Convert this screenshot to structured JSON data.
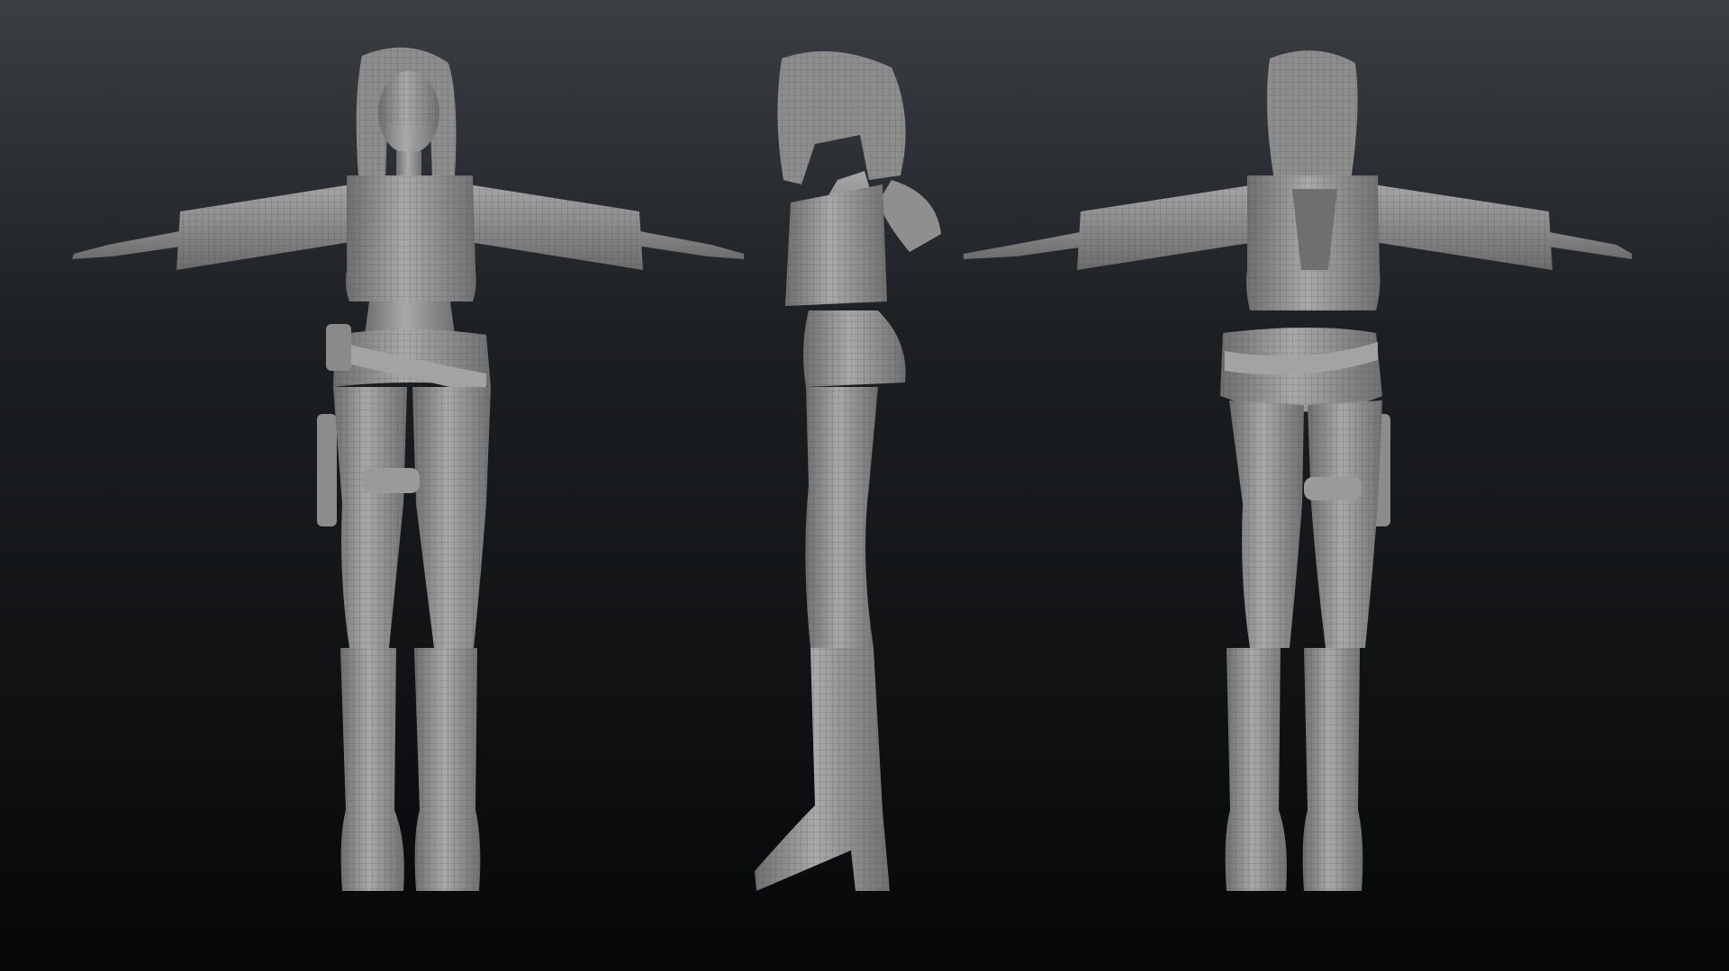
{
  "scene": {
    "background_top": "#3a3f44",
    "background_bottom": "#060708",
    "clay_color": "#9a9a9a",
    "clay_shadow": "#5e5e5e",
    "wire_color": "#4a4a4a"
  },
  "views": [
    {
      "name": "front-view"
    },
    {
      "name": "side-view"
    },
    {
      "name": "back-view"
    }
  ]
}
